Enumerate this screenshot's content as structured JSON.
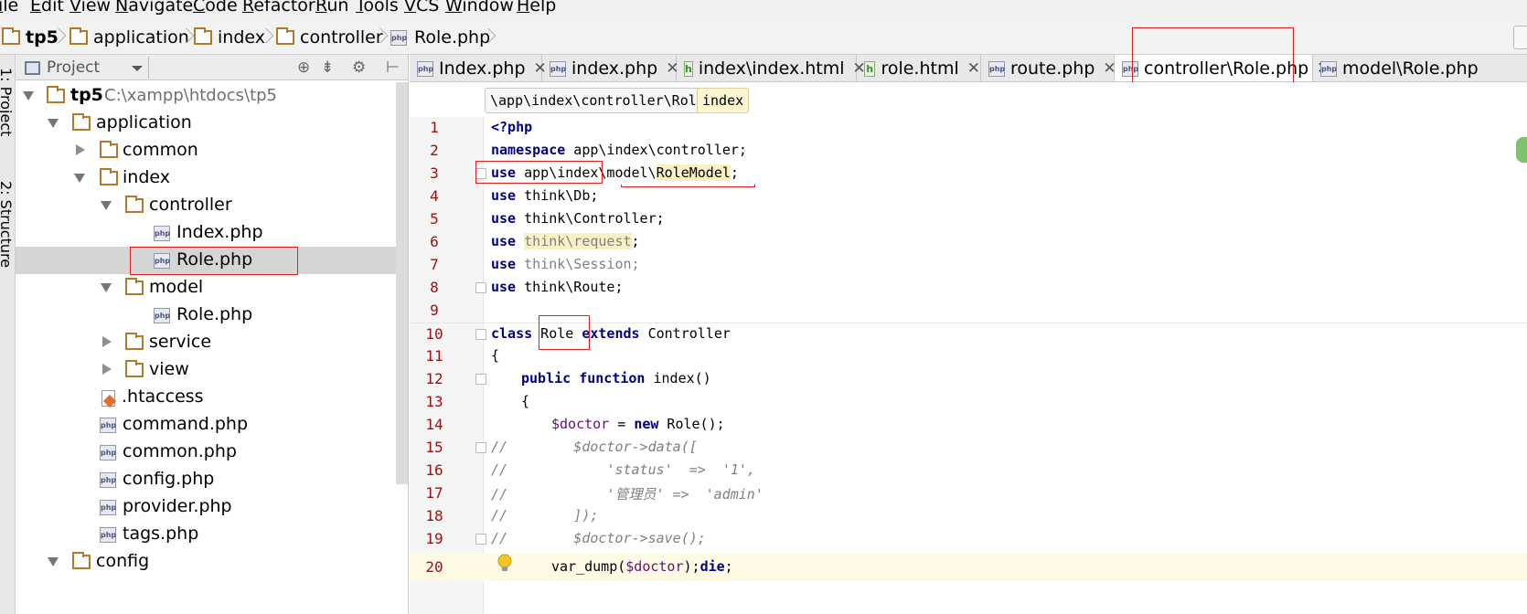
{
  "menu": [
    "ile",
    "Edit",
    "View",
    "Navigate",
    "Code",
    "Refactor",
    "Run",
    "Tools",
    "VCS",
    "Window",
    "Help"
  ],
  "navbar": {
    "crumbs": [
      "tp5",
      "application",
      "index",
      "controller",
      "Role.php"
    ]
  },
  "left_strip": {
    "project_label": "1: Project",
    "structure_label": "2: Structure"
  },
  "project_panel": {
    "title": "Project",
    "tree": [
      {
        "label": "tp5",
        "path": "C:\\xampp\\htdocs\\tp5",
        "type": "folder",
        "state": "open"
      },
      {
        "label": "application",
        "type": "folder",
        "state": "open"
      },
      {
        "label": "common",
        "type": "folder",
        "state": "closed"
      },
      {
        "label": "index",
        "type": "folder",
        "state": "open"
      },
      {
        "label": "controller",
        "type": "folder",
        "state": "open"
      },
      {
        "label": "Index.php",
        "type": "php"
      },
      {
        "label": "Role.php",
        "type": "php",
        "selected": true
      },
      {
        "label": "model",
        "type": "folder",
        "state": "open"
      },
      {
        "label": "Role.php",
        "type": "php"
      },
      {
        "label": "service",
        "type": "folder",
        "state": "closed"
      },
      {
        "label": "view",
        "type": "folder",
        "state": "closed"
      },
      {
        "label": ".htaccess",
        "type": "htaccess"
      },
      {
        "label": "command.php",
        "type": "php"
      },
      {
        "label": "common.php",
        "type": "php"
      },
      {
        "label": "config.php",
        "type": "php"
      },
      {
        "label": "provider.php",
        "type": "php"
      },
      {
        "label": "tags.php",
        "type": "php"
      },
      {
        "label": "config",
        "type": "folder",
        "state": "open"
      }
    ]
  },
  "tabs": [
    {
      "label": "Index.php",
      "icon": "php"
    },
    {
      "label": "index.php",
      "icon": "php"
    },
    {
      "label": "index\\index.html",
      "icon": "html"
    },
    {
      "label": "role.html",
      "icon": "html"
    },
    {
      "label": "route.php",
      "icon": "php"
    },
    {
      "label": "controller\\Role.php",
      "icon": "php",
      "active": true
    },
    {
      "label": "model\\Role.php",
      "icon": "php"
    }
  ],
  "editor_crumbs": [
    "\\app\\index\\controller\\Role",
    "index"
  ],
  "code": {
    "line_numbers": [
      "1",
      "2",
      "3",
      "4",
      "5",
      "6",
      "7",
      "8",
      "9",
      "10",
      "11",
      "12",
      "13",
      "14",
      "15",
      "16",
      "17",
      "18",
      "19",
      "20"
    ],
    "tokens": {
      "l1": "<?php",
      "l2_kw": "namespace",
      "l2_rest": " app\\index\\controller;",
      "use": "use",
      "l3_rest_a": " app\\index\\model\\",
      "l3_hl": "RoleModel",
      "l3_end": ";",
      "l4_rest": " think\\Db;",
      "l5_rest": " think\\Controller;",
      "l6_hl": "think\\request",
      "l6_end": ";",
      "l7_dim": " think\\Session;",
      "l8_rest": " think\\Route;",
      "l10_kw1": "class",
      "l10_name": " Role ",
      "l10_kw2": "extends",
      "l10_rest": " Controller",
      "l11": "{",
      "l12_kw1": "public",
      "l12_kw2": "function",
      "l12_rest": " index()",
      "l13": "{",
      "l14_var": "$doctor",
      "l14_eq": " = ",
      "l14_kw": "new",
      "l14_rest": " Role();",
      "l15": "//        $doctor->data([",
      "l16": "//            'status'  =>  '1',",
      "l17": "//            '管理员' =>  'admin'",
      "l18": "//        ]);",
      "l19": "//        $doctor->save();",
      "l20_fn": "var_dump(",
      "l20_var": "$doctor",
      "l20_mid": ");",
      "l20_kw": "die",
      "l20_end": ";"
    }
  },
  "colors": {
    "keyword": "#000080",
    "comment": "#808080",
    "variable": "#660e7a",
    "line_number": "#a01010",
    "annotation_box": "#e02020",
    "selected_row": "#d5d5d5",
    "current_line": "#fffae3"
  },
  "icons": {
    "project": "project-icon",
    "locate": "crosshair-icon",
    "collapse": "collapse-all-icon",
    "settings": "gear-icon",
    "hide": "hide-panel-icon",
    "lightbulb": "lightbulb-icon"
  }
}
